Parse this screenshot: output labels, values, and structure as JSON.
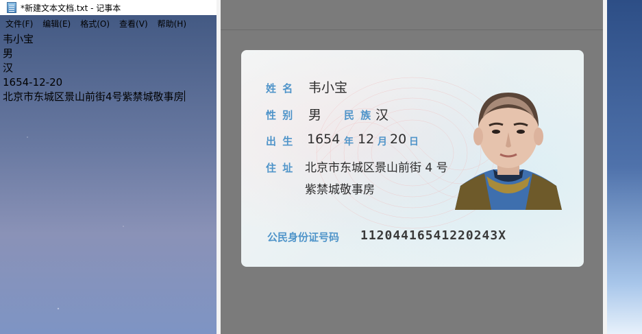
{
  "notepad": {
    "title": "*新建文本文档.txt - 记事本",
    "menu": [
      "文件(F)",
      "编辑(E)",
      "格式(O)",
      "查看(V)",
      "帮助(H)"
    ],
    "lines": [
      "韦小宝",
      "男",
      "汉",
      "1654-12-20",
      "北京市东城区景山前街4号紫禁城敬事房"
    ]
  },
  "idcard": {
    "labels": {
      "name": "姓 名",
      "gender": "性 别",
      "ethnicity": "民 族",
      "birth": "出 生",
      "year": "年",
      "month": "月",
      "day": "日",
      "address": "住 址",
      "id": "公民身份证号码"
    },
    "values": {
      "name": "韦小宝",
      "gender": "男",
      "ethnicity": "汉",
      "birth_year": "1654",
      "birth_month": "12",
      "birth_day": "20",
      "address_line1": "北京市东城区景山前街 4 号",
      "address_line2": "紫禁城敬事房",
      "id_number": "11204416541220243X"
    }
  },
  "colors": {
    "viewer_bg": "#7b7b7b",
    "label_blue": "#4f94c9"
  }
}
